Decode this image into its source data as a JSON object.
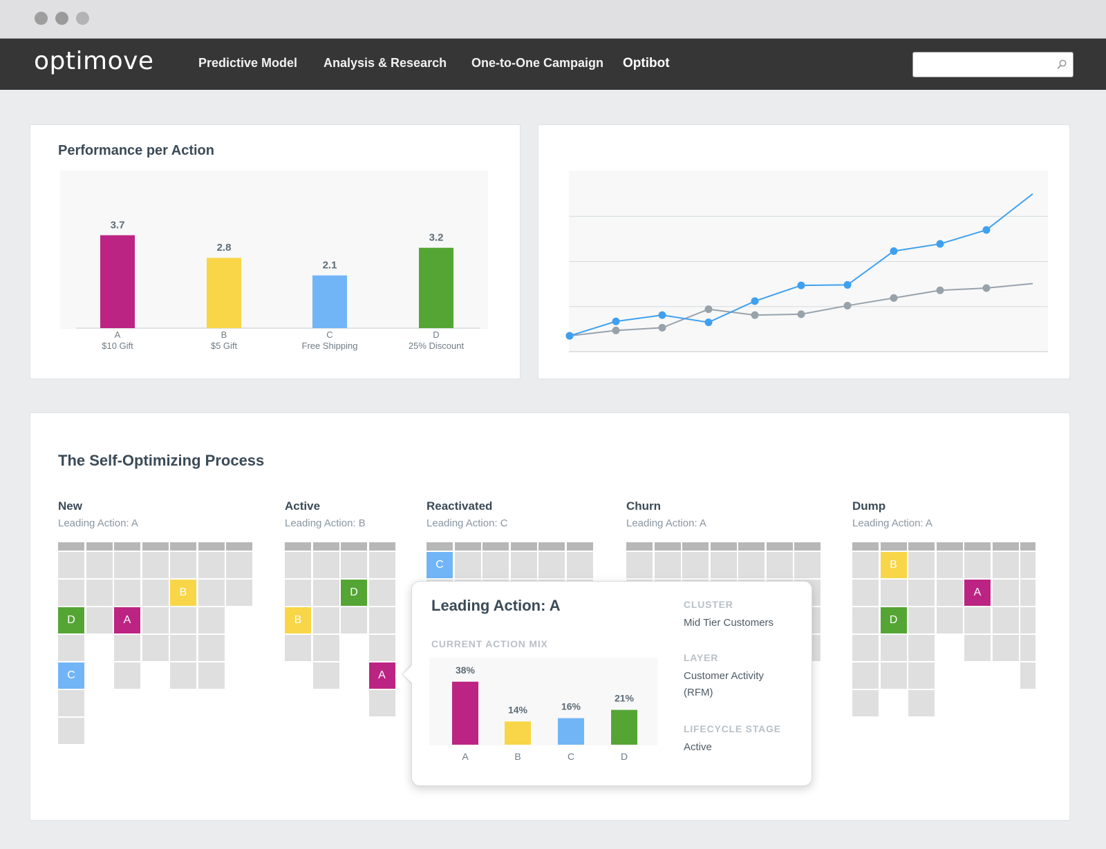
{
  "window": {
    "controls": [
      {
        "name": "close",
        "color": "#9e9e9e"
      },
      {
        "name": "minimize",
        "color": "#9a9a9a"
      },
      {
        "name": "maximize",
        "color": "#b3b3b3"
      }
    ]
  },
  "header": {
    "logo": "optimove",
    "nav": [
      {
        "label": "Predictive Model",
        "active": false
      },
      {
        "label": "Analysis & Research",
        "active": false
      },
      {
        "label": "One-to-One Campaign",
        "active": false
      },
      {
        "label": "Optibot",
        "active": true
      }
    ],
    "search": {
      "value": "",
      "placeholder": "",
      "icon": "search-icon"
    }
  },
  "colors": {
    "A": "#bc2483",
    "B": "#f8d647",
    "C": "#72b5f7",
    "D": "#55a535",
    "line_blue": "#3fa0f0",
    "line_gray": "#97a2ab",
    "header_bg": "#363636",
    "page_bg": "#ebecee"
  },
  "performance_card": {
    "title": "Performance per Action"
  },
  "chart_data": [
    {
      "type": "bar",
      "title": "Performance per Action",
      "categories": [
        "A",
        "B",
        "C",
        "D"
      ],
      "category_sublabels": [
        "$10 Gift",
        "$5 Gift",
        "Free Shipping",
        "25% Discount"
      ],
      "values": [
        3.7,
        2.8,
        2.1,
        3.2
      ],
      "value_labels": [
        "3.7",
        "2.8",
        "2.1",
        "3.2"
      ],
      "colors": [
        "#bc2483",
        "#f8d647",
        "#72b5f7",
        "#55a535"
      ],
      "xlabel": "",
      "ylabel": "",
      "ylim": [
        0,
        6.3
      ],
      "grid": false
    },
    {
      "type": "line",
      "title": "",
      "x": [
        1,
        2,
        3,
        4,
        5,
        6,
        7,
        8,
        9,
        10,
        11
      ],
      "series": [
        {
          "name": "blue",
          "color": "#3fa0f0",
          "values": [
            0.35,
            0.67,
            0.81,
            0.65,
            1.12,
            1.47,
            1.48,
            2.23,
            2.39,
            2.7,
            3.5
          ],
          "markers_on_last": false
        },
        {
          "name": "gray",
          "color": "#97a2ab",
          "values": [
            0.35,
            0.47,
            0.53,
            0.94,
            0.81,
            0.83,
            1.02,
            1.19,
            1.36,
            1.41,
            1.51
          ],
          "markers_on_last": false
        }
      ],
      "xlabel": "",
      "ylabel": "",
      "ylim": [
        0,
        4
      ],
      "grid_lines": [
        1,
        2,
        3
      ],
      "grid": true,
      "legend": "none"
    },
    {
      "type": "bar",
      "title": "Current Action Mix",
      "categories": [
        "A",
        "B",
        "C",
        "D"
      ],
      "values": [
        38,
        14,
        16,
        21
      ],
      "value_labels": [
        "38%",
        "14%",
        "16%",
        "21%"
      ],
      "colors": [
        "#bc2483",
        "#f8d647",
        "#72b5f7",
        "#55a535"
      ],
      "ylim": [
        0,
        48
      ],
      "grid": false
    }
  ],
  "process": {
    "title": "The Self-Optimizing Process",
    "groups": [
      {
        "title": "New",
        "subtitle": "Leading Action: A",
        "columns": [
          {
            "cells": [
              "",
              "",
              "D",
              "",
              "C",
              "",
              ""
            ]
          },
          {
            "cells": [
              "",
              "",
              ""
            ]
          },
          {
            "cells": [
              "",
              "",
              "A",
              "",
              ""
            ]
          },
          {
            "cells": [
              "",
              "",
              "",
              ""
            ]
          },
          {
            "cells": [
              "",
              "B",
              "",
              "",
              ""
            ]
          },
          {
            "cells": [
              "",
              "",
              "",
              "",
              ""
            ]
          },
          {
            "cells": [
              "",
              ""
            ]
          }
        ]
      },
      {
        "title": "Active",
        "subtitle": "Leading Action: B",
        "columns": [
          {
            "cells": [
              "",
              "",
              "B",
              ""
            ]
          },
          {
            "cells": [
              "",
              "",
              "",
              "",
              ""
            ]
          },
          {
            "cells": [
              "",
              "D",
              ""
            ]
          },
          {
            "cells": [
              "",
              "",
              "",
              "",
              "A",
              ""
            ]
          }
        ]
      },
      {
        "title": "Reactivated",
        "subtitle": "Leading Action: C",
        "columns": [
          {
            "cells": [
              "C",
              ""
            ]
          },
          {
            "cells": [
              "",
              ""
            ]
          },
          {
            "cells": [
              "",
              ""
            ]
          },
          {
            "cells": [
              "",
              ""
            ]
          },
          {
            "cells": [
              "",
              ""
            ]
          },
          {
            "cells": [
              "",
              ""
            ]
          }
        ]
      },
      {
        "title": "Churn",
        "subtitle": "Leading Action: A",
        "columns": [
          {
            "cells": [
              "",
              ""
            ]
          },
          {
            "cells": [
              "",
              ""
            ]
          },
          {
            "cells": [
              "",
              ""
            ]
          },
          {
            "cells": [
              "",
              ""
            ]
          },
          {
            "cells": [
              "",
              ""
            ]
          },
          {
            "cells": [
              "",
              ""
            ]
          },
          {
            "cells": [
              "",
              "",
              "",
              ""
            ]
          }
        ]
      },
      {
        "title": "Dump",
        "subtitle": "Leading Action: A",
        "columns": [
          {
            "cells": [
              "",
              "",
              "",
              "",
              "",
              ""
            ]
          },
          {
            "cells": [
              "B",
              "",
              "D",
              "",
              ""
            ]
          },
          {
            "cells": [
              "",
              "",
              "",
              "",
              "",
              ""
            ]
          },
          {
            "cells": [
              "",
              "",
              ""
            ]
          },
          {
            "cells": [
              "",
              "A",
              "",
              ""
            ]
          },
          {
            "cells": [
              "",
              "",
              "",
              ""
            ]
          },
          {
            "cells": [
              "",
              "",
              "",
              "",
              ""
            ]
          }
        ]
      }
    ]
  },
  "tooltip": {
    "title": "Leading Action: A",
    "mix_label": "CURRENT ACTION MIX",
    "meta": [
      {
        "key": "CLUSTER",
        "value": "Mid Tier Customers"
      },
      {
        "key": "LAYER",
        "value": "Customer Activity (RFM)"
      },
      {
        "key": "LIFECYCLE STAGE",
        "value": "Active"
      }
    ]
  }
}
